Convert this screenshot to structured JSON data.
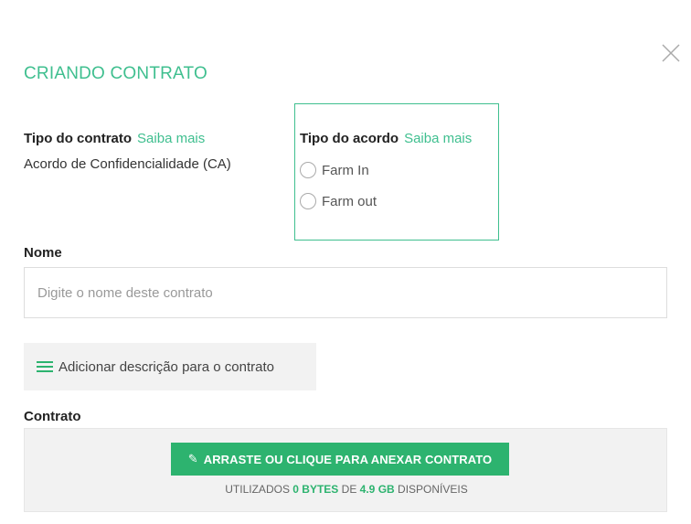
{
  "modal": {
    "title": "CRIANDO CONTRATO",
    "close_icon": "close-icon"
  },
  "tipo_contrato": {
    "label": "Tipo do contrato",
    "link": "Saiba mais",
    "value": "Acordo de Confidencialidade (CA)"
  },
  "tipo_acordo": {
    "label": "Tipo do acordo",
    "link": "Saiba mais",
    "options": [
      {
        "label": "Farm In",
        "selected": false
      },
      {
        "label": "Farm out",
        "selected": false
      }
    ]
  },
  "nome": {
    "label": "Nome",
    "placeholder": "Digite o nome deste contrato",
    "value": ""
  },
  "descricao": {
    "button_label": "Adicionar descrição para o contrato",
    "icon": "list-icon"
  },
  "contrato": {
    "label": "Contrato",
    "upload_label": "ARRASTE OU CLIQUE PARA ANEXAR CONTRATO",
    "upload_icon": "paperclip-icon",
    "usage_prefix": "UTILIZADOS",
    "used": "0 BYTES",
    "usage_mid": "DE",
    "total": "4.9 GB",
    "usage_suffix": "DISPONÍVEIS"
  },
  "colors": {
    "accent": "#3fbf8f",
    "button": "#2db36f"
  }
}
